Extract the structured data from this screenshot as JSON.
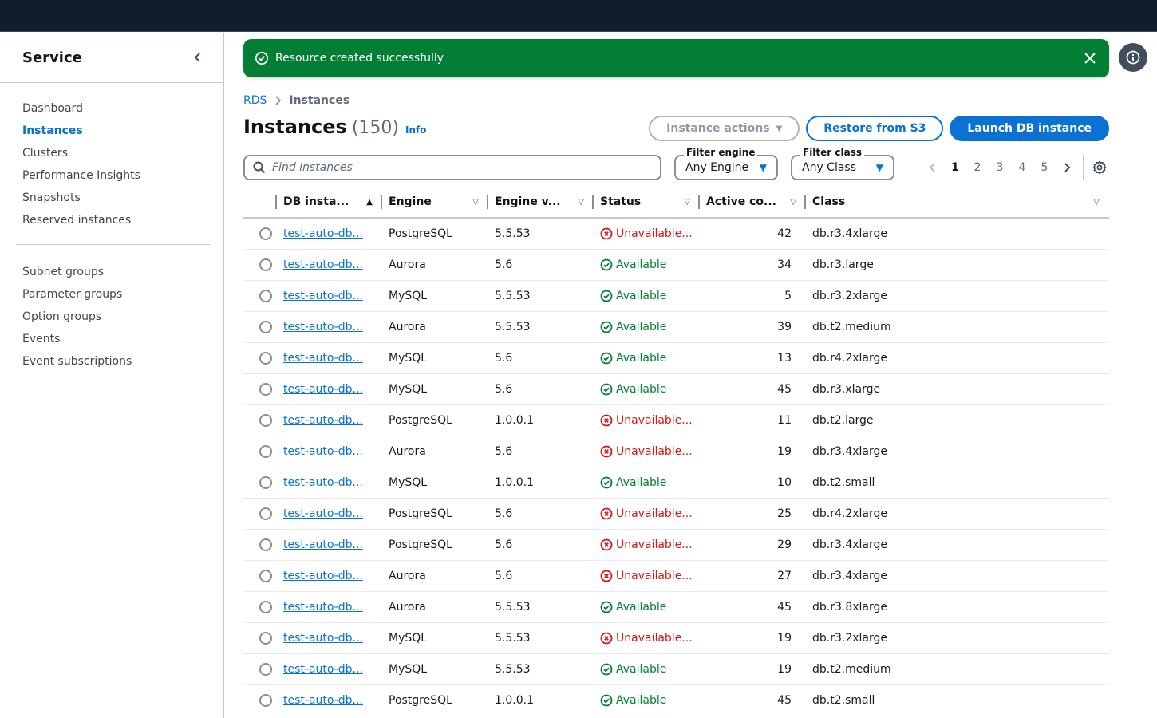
{
  "sidebar": {
    "title": "Service",
    "items_top": [
      {
        "label": "Dashboard",
        "active": false
      },
      {
        "label": "Instances",
        "active": true
      },
      {
        "label": "Clusters",
        "active": false
      },
      {
        "label": "Performance Insights",
        "active": false
      },
      {
        "label": "Snapshots",
        "active": false
      },
      {
        "label": "Reserved instances",
        "active": false
      }
    ],
    "items_bottom": [
      {
        "label": "Subnet groups"
      },
      {
        "label": "Parameter groups"
      },
      {
        "label": "Option groups"
      },
      {
        "label": "Events"
      },
      {
        "label": "Event subscriptions"
      }
    ]
  },
  "flash": {
    "message": "Resource created successfully",
    "color": "#037f35"
  },
  "breadcrumb": {
    "parent": "RDS",
    "current": "Instances"
  },
  "header": {
    "title": "Instances",
    "count": "(150)",
    "info": "Info"
  },
  "actions": {
    "instance_actions": "Instance actions",
    "restore": "Restore from S3",
    "launch": "Launch DB instance"
  },
  "search": {
    "placeholder": "Find instances",
    "value": ""
  },
  "filters": {
    "engine": {
      "label": "Filter engine",
      "value": "Any Engine"
    },
    "class": {
      "label": "Filter class",
      "value": "Any Class"
    }
  },
  "pagination": {
    "pages": [
      "1",
      "2",
      "3",
      "4",
      "5"
    ],
    "current": "1"
  },
  "table": {
    "columns": [
      "DB insta...",
      "Engine",
      "Engine v...",
      "Status",
      "Active co...",
      "Class"
    ],
    "rows": [
      {
        "name": "test-auto-db...",
        "engine": "PostgreSQL",
        "version": "5.5.53",
        "status": "Unavailable...",
        "ok": false,
        "active": "42",
        "class": "db.r3.4xlarge"
      },
      {
        "name": "test-auto-db...",
        "engine": "Aurora",
        "version": "5.6",
        "status": "Available",
        "ok": true,
        "active": "34",
        "class": "db.r3.large"
      },
      {
        "name": "test-auto-db...",
        "engine": "MySQL",
        "version": "5.5.53",
        "status": "Available",
        "ok": true,
        "active": "5",
        "class": "db.r3.2xlarge"
      },
      {
        "name": "test-auto-db...",
        "engine": "Aurora",
        "version": "5.5.53",
        "status": "Available",
        "ok": true,
        "active": "39",
        "class": "db.t2.medium"
      },
      {
        "name": "test-auto-db...",
        "engine": "MySQL",
        "version": "5.6",
        "status": "Available",
        "ok": true,
        "active": "13",
        "class": "db.r4.2xlarge"
      },
      {
        "name": "test-auto-db...",
        "engine": "MySQL",
        "version": "5.6",
        "status": "Available",
        "ok": true,
        "active": "45",
        "class": "db.r3.xlarge"
      },
      {
        "name": "test-auto-db...",
        "engine": "PostgreSQL",
        "version": "1.0.0.1",
        "status": "Unavailable...",
        "ok": false,
        "active": "11",
        "class": "db.t2.large"
      },
      {
        "name": "test-auto-db...",
        "engine": "Aurora",
        "version": "5.6",
        "status": "Unavailable...",
        "ok": false,
        "active": "19",
        "class": "db.r3.4xlarge"
      },
      {
        "name": "test-auto-db...",
        "engine": "MySQL",
        "version": "1.0.0.1",
        "status": "Available",
        "ok": true,
        "active": "10",
        "class": "db.t2.small"
      },
      {
        "name": "test-auto-db...",
        "engine": "PostgreSQL",
        "version": "5.6",
        "status": "Unavailable...",
        "ok": false,
        "active": "25",
        "class": "db.r4.2xlarge"
      },
      {
        "name": "test-auto-db...",
        "engine": "PostgreSQL",
        "version": "5.6",
        "status": "Unavailable...",
        "ok": false,
        "active": "29",
        "class": "db.r3.4xlarge"
      },
      {
        "name": "test-auto-db...",
        "engine": "Aurora",
        "version": "5.6",
        "status": "Unavailable...",
        "ok": false,
        "active": "27",
        "class": "db.r3.4xlarge"
      },
      {
        "name": "test-auto-db...",
        "engine": "Aurora",
        "version": "5.5.53",
        "status": "Available",
        "ok": true,
        "active": "45",
        "class": "db.r3.8xlarge"
      },
      {
        "name": "test-auto-db...",
        "engine": "MySQL",
        "version": "5.5.53",
        "status": "Unavailable...",
        "ok": false,
        "active": "19",
        "class": "db.r3.2xlarge"
      },
      {
        "name": "test-auto-db...",
        "engine": "MySQL",
        "version": "5.5.53",
        "status": "Available",
        "ok": true,
        "active": "19",
        "class": "db.t2.medium"
      },
      {
        "name": "test-auto-db...",
        "engine": "PostgreSQL",
        "version": "1.0.0.1",
        "status": "Available",
        "ok": true,
        "active": "45",
        "class": "db.t2.small"
      }
    ]
  }
}
